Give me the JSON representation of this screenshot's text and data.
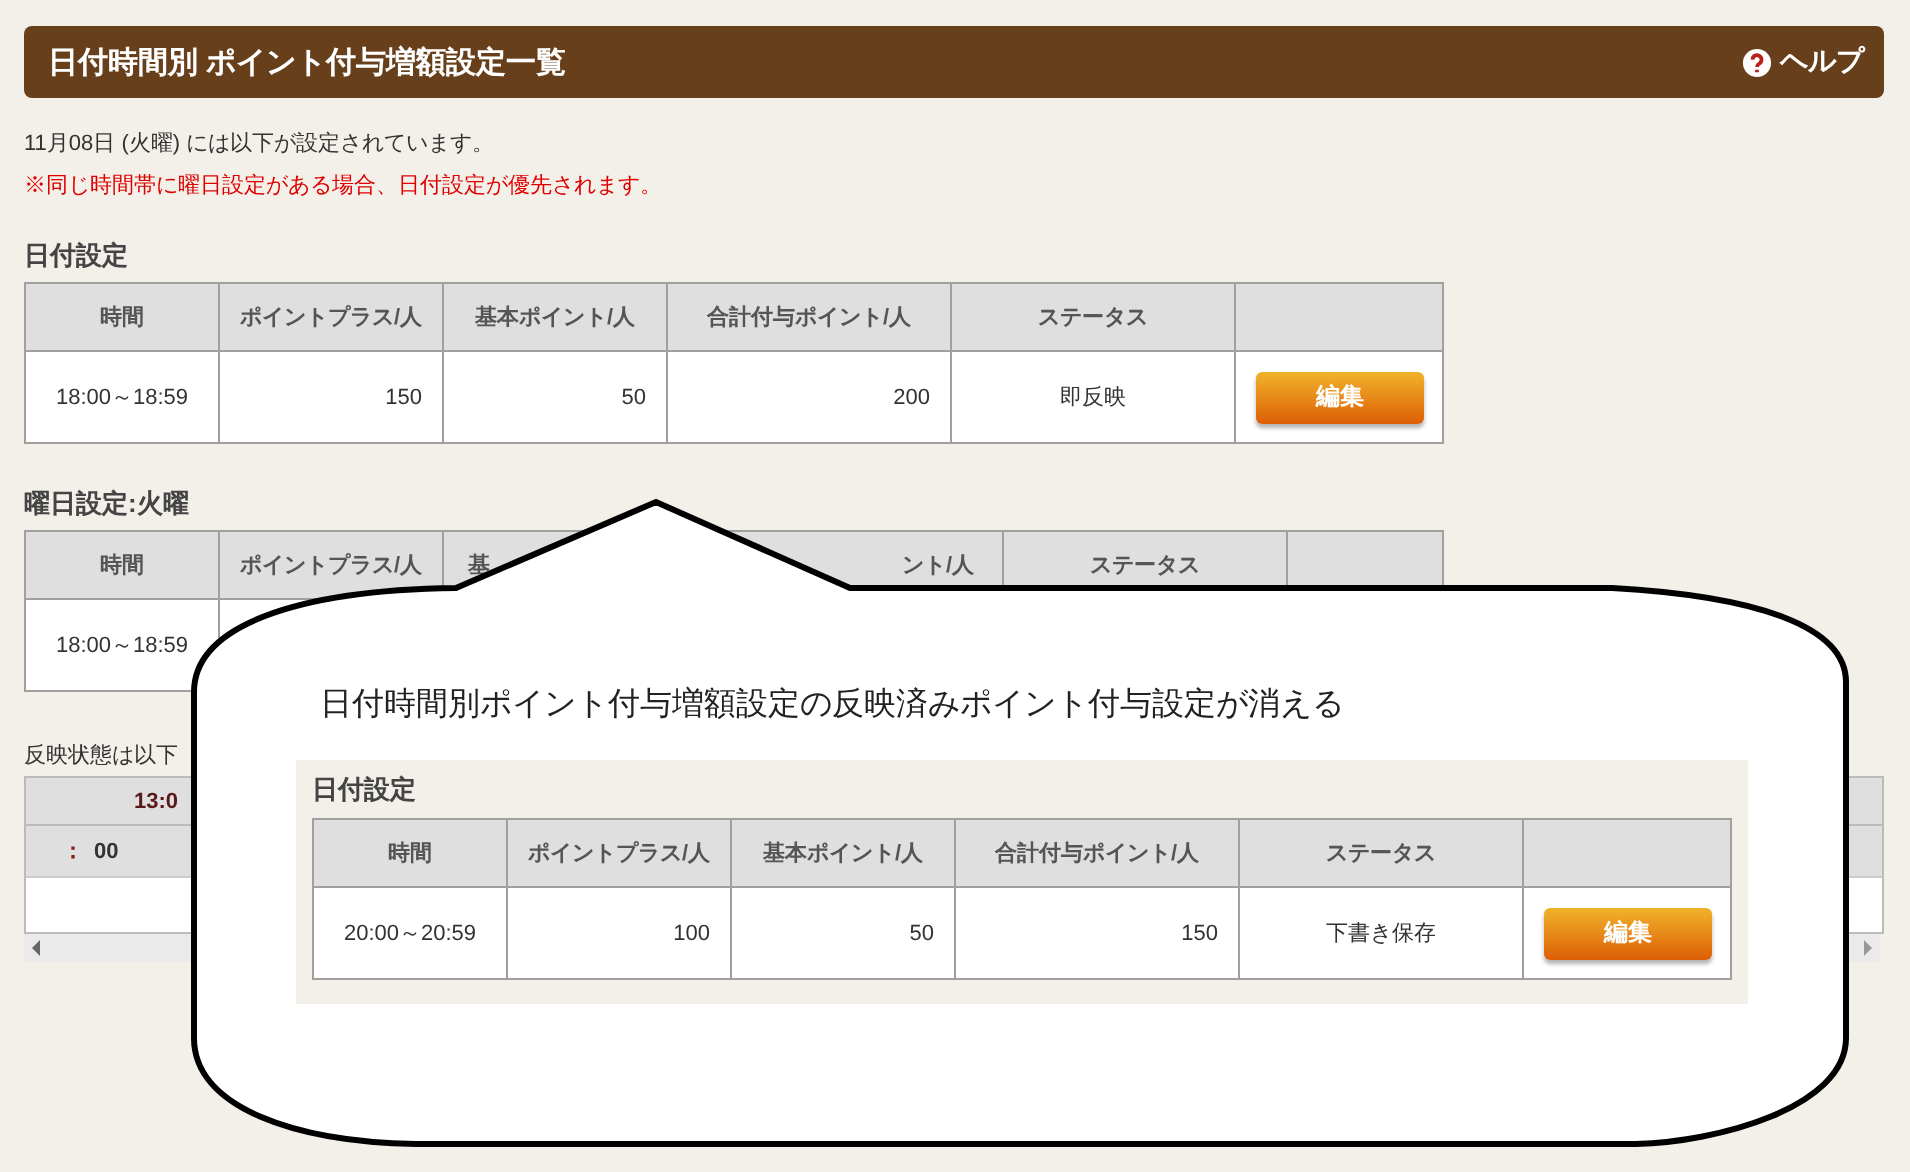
{
  "header": {
    "title": "日付時間別 ポイント付与増額設定一覧",
    "help": "ヘルプ"
  },
  "notes": [
    {
      "kind": "info",
      "text": "11月08日 (火曜) には以下が設定されています。"
    },
    {
      "kind": "warning",
      "text": "※同じ時間帯に曜日設定がある場合、日付設定が優先されます。"
    }
  ],
  "date_settings": {
    "title": "日付設定",
    "columns": [
      "時間",
      "ポイントプラス/人",
      "基本ポイント/人",
      "合計付与ポイント/人",
      "ステータス"
    ],
    "rows": [
      {
        "time": "18:00～18:59",
        "plus": "150",
        "base": "50",
        "total": "200",
        "status": "即反映",
        "action": "編集"
      }
    ]
  },
  "weekday_settings": {
    "title": "曜日設定:火曜",
    "columns": [
      "時間",
      "ポイントプラス/人",
      "基",
      "ント/人",
      "ステータス"
    ],
    "rows": [
      {
        "time": "18:00～18:59"
      }
    ]
  },
  "reflection": {
    "text": "反映状態は以下",
    "header": "13:0",
    "subheader": [
      "：",
      "00"
    ]
  },
  "callout": {
    "text": "日付時間別ポイント付与増額設定の反映済みポイント付与設定が消える",
    "panel": {
      "title": "日付設定",
      "columns": [
        "時間",
        "ポイントプラス/人",
        "基本ポイント/人",
        "合計付与ポイント/人",
        "ステータス"
      ],
      "rows": [
        {
          "time": "20:00～20:59",
          "plus": "100",
          "base": "50",
          "total": "150",
          "status": "下書き保存",
          "action": "編集"
        }
      ]
    }
  }
}
